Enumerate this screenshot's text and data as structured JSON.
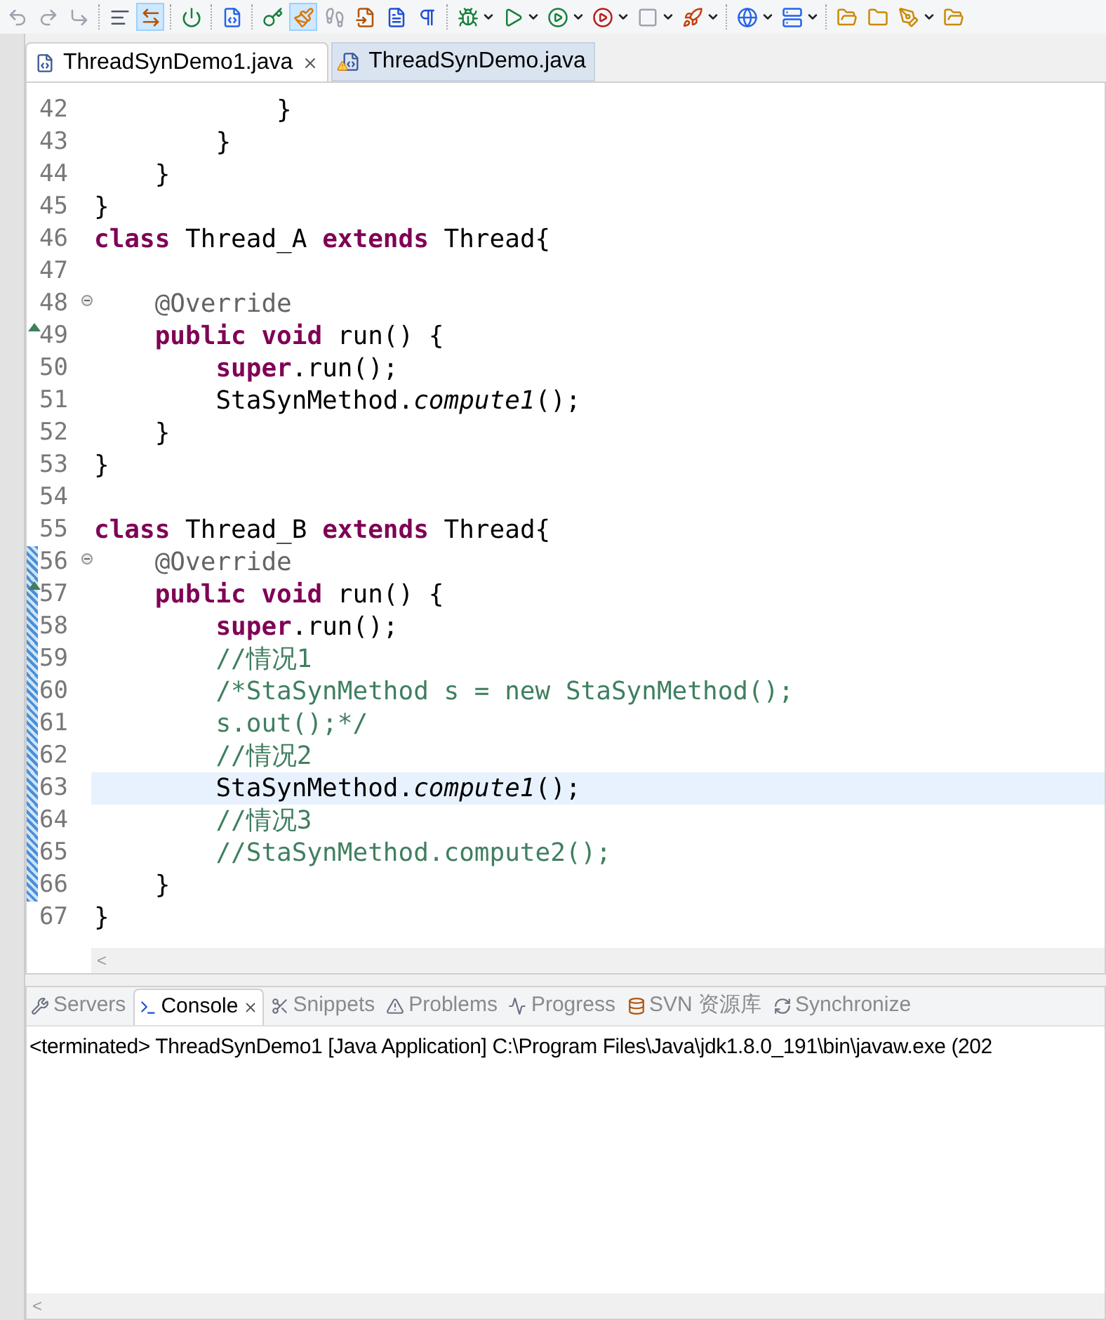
{
  "toolbar": [
    {
      "kind": "undo",
      "selected": false,
      "dropdown": false
    },
    {
      "kind": "redo",
      "selected": false,
      "dropdown": false
    },
    {
      "kind": "step",
      "selected": false,
      "dropdown": false
    },
    {
      "kind": "sep"
    },
    {
      "kind": "format",
      "selected": false,
      "dropdown": false
    },
    {
      "kind": "toggle",
      "selected": true,
      "dropdown": false
    },
    {
      "kind": "sep"
    },
    {
      "kind": "power",
      "selected": false,
      "dropdown": false
    },
    {
      "kind": "sep"
    },
    {
      "kind": "ajax",
      "selected": false,
      "dropdown": false
    },
    {
      "kind": "sep"
    },
    {
      "kind": "key",
      "selected": false,
      "dropdown": false
    },
    {
      "kind": "brush",
      "selected": true,
      "dropdown": false
    },
    {
      "kind": "steps",
      "selected": false,
      "dropdown": false
    },
    {
      "kind": "import",
      "selected": false,
      "dropdown": false
    },
    {
      "kind": "page",
      "selected": false,
      "dropdown": false
    },
    {
      "kind": "pilcrow",
      "selected": false,
      "dropdown": false
    },
    {
      "kind": "sep"
    },
    {
      "kind": "bug",
      "selected": false,
      "dropdown": true
    },
    {
      "kind": "run",
      "selected": false,
      "dropdown": true
    },
    {
      "kind": "runext",
      "selected": false,
      "dropdown": true
    },
    {
      "kind": "runother",
      "selected": false,
      "dropdown": true
    },
    {
      "kind": "stop",
      "selected": false,
      "dropdown": true
    },
    {
      "kind": "deploy",
      "selected": false,
      "dropdown": true
    },
    {
      "kind": "sep"
    },
    {
      "kind": "globe",
      "selected": false,
      "dropdown": true
    },
    {
      "kind": "server",
      "selected": false,
      "dropdown": true
    },
    {
      "kind": "sep"
    },
    {
      "kind": "folderopen",
      "selected": false,
      "dropdown": false
    },
    {
      "kind": "folder",
      "selected": false,
      "dropdown": false
    },
    {
      "kind": "pen",
      "selected": false,
      "dropdown": true
    },
    {
      "kind": "folderopen",
      "selected": false,
      "dropdown": false
    }
  ],
  "editor_tabs": [
    {
      "label": "ThreadSynDemo1.java",
      "selected": true,
      "closable": true,
      "warning": false
    },
    {
      "label": "ThreadSynDemo.java",
      "selected": false,
      "closable": false,
      "warning": true
    }
  ],
  "code_lines": [
    {
      "number": "42",
      "fold": false,
      "override": false,
      "changed": false,
      "current": false,
      "tokens": [
        {
          "kind": "plain",
          "text": "            }"
        }
      ]
    },
    {
      "number": "43",
      "fold": false,
      "override": false,
      "changed": false,
      "current": false,
      "tokens": [
        {
          "kind": "plain",
          "text": "        }"
        }
      ]
    },
    {
      "number": "44",
      "fold": false,
      "override": false,
      "changed": false,
      "current": false,
      "tokens": [
        {
          "kind": "plain",
          "text": "    }"
        }
      ]
    },
    {
      "number": "45",
      "fold": false,
      "override": false,
      "changed": false,
      "current": false,
      "tokens": [
        {
          "kind": "plain",
          "text": "}"
        }
      ]
    },
    {
      "number": "46",
      "fold": false,
      "override": false,
      "changed": false,
      "current": false,
      "tokens": [
        {
          "kind": "keyword",
          "text": "class"
        },
        {
          "kind": "plain",
          "text": " Thread_A "
        },
        {
          "kind": "keyword",
          "text": "extends"
        },
        {
          "kind": "plain",
          "text": " Thread{"
        }
      ]
    },
    {
      "number": "47",
      "fold": false,
      "override": false,
      "changed": false,
      "current": false
    },
    {
      "number": "48",
      "fold": true,
      "override": false,
      "changed": false,
      "current": false,
      "tokens": [
        {
          "kind": "annotation",
          "text": "    @Override"
        }
      ]
    },
    {
      "number": "49",
      "fold": false,
      "override": true,
      "changed": false,
      "current": false,
      "tokens": [
        {
          "kind": "keyword",
          "text": "    public void"
        },
        {
          "kind": "plain",
          "text": " run() {"
        }
      ]
    },
    {
      "number": "50",
      "fold": false,
      "override": false,
      "changed": false,
      "current": false,
      "tokens": [
        {
          "kind": "keyword",
          "text": "        super"
        },
        {
          "kind": "plain",
          "text": ".run();"
        }
      ]
    },
    {
      "number": "51",
      "fold": false,
      "override": false,
      "changed": false,
      "current": false,
      "tokens": [
        {
          "kind": "plain",
          "text": "        StaSynMethod."
        },
        {
          "kind": "italic",
          "text": "compute1"
        },
        {
          "kind": "plain",
          "text": "();"
        }
      ]
    },
    {
      "number": "52",
      "fold": false,
      "override": false,
      "changed": false,
      "current": false,
      "tokens": [
        {
          "kind": "plain",
          "text": "    }"
        }
      ]
    },
    {
      "number": "53",
      "fold": false,
      "override": false,
      "changed": false,
      "current": false,
      "tokens": [
        {
          "kind": "plain",
          "text": "}"
        }
      ]
    },
    {
      "number": "54",
      "fold": false,
      "override": false,
      "changed": false,
      "current": false
    },
    {
      "number": "55",
      "fold": false,
      "override": false,
      "changed": false,
      "current": false,
      "tokens": [
        {
          "kind": "keyword",
          "text": "class"
        },
        {
          "kind": "plain",
          "text": " Thread_B "
        },
        {
          "kind": "keyword",
          "text": "extends"
        },
        {
          "kind": "plain",
          "text": " Thread{"
        }
      ]
    },
    {
      "number": "56",
      "fold": true,
      "override": false,
      "changed": true,
      "current": false,
      "tokens": [
        {
          "kind": "annotation",
          "text": "    @Override"
        }
      ]
    },
    {
      "number": "57",
      "fold": false,
      "override": true,
      "changed": true,
      "current": false,
      "tokens": [
        {
          "kind": "keyword",
          "text": "    public void"
        },
        {
          "kind": "plain",
          "text": " run() {"
        }
      ]
    },
    {
      "number": "58",
      "fold": false,
      "override": false,
      "changed": true,
      "current": false,
      "tokens": [
        {
          "kind": "keyword",
          "text": "        super"
        },
        {
          "kind": "plain",
          "text": ".run();"
        }
      ]
    },
    {
      "number": "59",
      "fold": false,
      "override": false,
      "changed": true,
      "current": false,
      "tokens": [
        {
          "kind": "comment",
          "text": "        //情况1"
        }
      ]
    },
    {
      "number": "60",
      "fold": false,
      "override": false,
      "changed": true,
      "current": false,
      "tokens": [
        {
          "kind": "comment",
          "text": "        /*StaSynMethod s = new StaSynMethod();"
        }
      ]
    },
    {
      "number": "61",
      "fold": false,
      "override": false,
      "changed": true,
      "current": false,
      "tokens": [
        {
          "kind": "comment",
          "text": "        s.out();*/"
        }
      ]
    },
    {
      "number": "62",
      "fold": false,
      "override": false,
      "changed": true,
      "current": false,
      "tokens": [
        {
          "kind": "comment",
          "text": "        //情况2"
        }
      ]
    },
    {
      "number": "63",
      "fold": false,
      "override": false,
      "changed": true,
      "current": true,
      "tokens": [
        {
          "kind": "plain",
          "text": "        StaSynMethod."
        },
        {
          "kind": "italic",
          "text": "compute1"
        },
        {
          "kind": "plain",
          "text": "();"
        }
      ]
    },
    {
      "number": "64",
      "fold": false,
      "override": false,
      "changed": true,
      "current": false,
      "tokens": [
        {
          "kind": "comment",
          "text": "        //情况3"
        }
      ]
    },
    {
      "number": "65",
      "fold": false,
      "override": false,
      "changed": true,
      "current": false,
      "tokens": [
        {
          "kind": "comment",
          "text": "        //StaSynMethod.compute2();"
        }
      ]
    },
    {
      "number": "66",
      "fold": false,
      "override": false,
      "changed": true,
      "current": false,
      "tokens": [
        {
          "kind": "plain",
          "text": "    }"
        }
      ]
    },
    {
      "number": "67",
      "fold": false,
      "override": false,
      "changed": false,
      "current": false,
      "tokens": [
        {
          "kind": "plain",
          "text": "}"
        }
      ]
    }
  ],
  "editor_scroll_arrow": "<",
  "panel_tabs": [
    {
      "kind": "servers",
      "label": "Servers",
      "selected": false,
      "closable": false
    },
    {
      "kind": "console",
      "label": "Console",
      "selected": true,
      "closable": true
    },
    {
      "kind": "snippets",
      "label": "Snippets",
      "selected": false,
      "closable": false
    },
    {
      "kind": "problems",
      "label": "Problems",
      "selected": false,
      "closable": false
    },
    {
      "kind": "progress",
      "label": "Progress",
      "selected": false,
      "closable": false
    },
    {
      "kind": "svn",
      "label": "SVN 资源库",
      "selected": false,
      "closable": false
    },
    {
      "kind": "sync",
      "label": "Synchronize",
      "selected": false,
      "closable": false
    }
  ],
  "console_text": "<terminated> ThreadSynDemo1 [Java Application] C:\\Program Files\\Java\\jdk1.8.0_191\\bin\\javaw.exe (202",
  "console_scroll_arrow": "<"
}
